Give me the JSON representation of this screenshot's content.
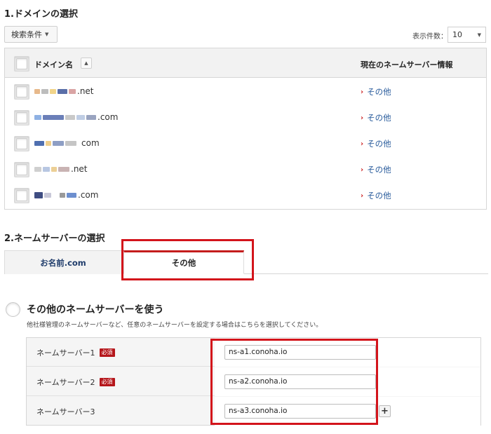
{
  "section1": {
    "title": "1.ドメインの選択",
    "filter_label": "検索条件",
    "display_count_label": "表示件数：",
    "display_count_value": "10"
  },
  "domain_table": {
    "col_domain": "ドメイン名",
    "col_ns": "現在のネームサーバー情報",
    "rows": [
      {
        "domain_suffix": ".net",
        "ns": "その他"
      },
      {
        "domain_suffix": ".com",
        "ns": "その他"
      },
      {
        "domain_suffix": "com",
        "ns": "その他"
      },
      {
        "domain_suffix": ".net",
        "ns": "その他"
      },
      {
        "domain_suffix": ".com",
        "ns": "その他"
      }
    ]
  },
  "section2": {
    "title": "2.ネームサーバーの選択",
    "tabs": [
      {
        "label": "お名前.com"
      },
      {
        "label": "その他"
      }
    ],
    "active_tab": "その他"
  },
  "other_ns": {
    "title": "その他のネームサーバーを使う",
    "description": "他社様管理のネームサーバーなど、任意のネームサーバーを設定する場合はこちらを選択してください。",
    "required_label": "必須",
    "servers": [
      {
        "label": "ネームサーバー1",
        "value": "ns-a1.conoha.io",
        "required": true
      },
      {
        "label": "ネームサーバー2",
        "value": "ns-a2.conoha.io",
        "required": true
      },
      {
        "label": "ネームサーバー3",
        "value": "ns-a3.conoha.io",
        "required": false
      }
    ],
    "add_button": "+"
  },
  "colors": {
    "accent_red": "#d3141b",
    "link_blue": "#2a5c9c",
    "required_badge": "#b5161b"
  }
}
